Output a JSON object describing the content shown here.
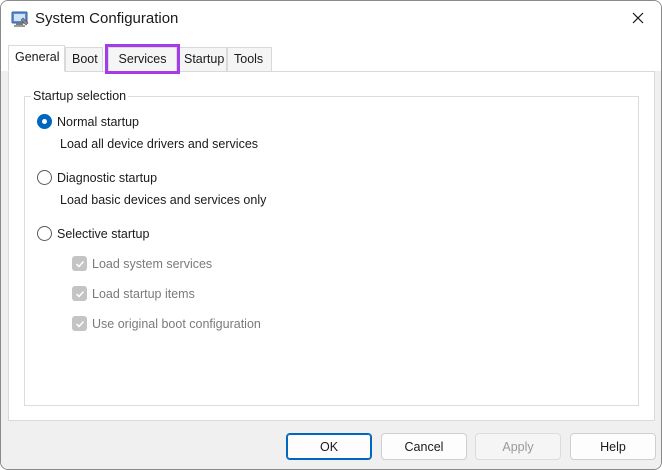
{
  "window": {
    "title": "System Configuration",
    "app_icon": "system-config-icon",
    "close_icon": "close-icon"
  },
  "tabs": [
    {
      "label": "General",
      "active": true
    },
    {
      "label": "Boot",
      "active": false
    },
    {
      "label": "Services",
      "active": false,
      "highlighted": true
    },
    {
      "label": "Startup",
      "active": false
    },
    {
      "label": "Tools",
      "active": false
    }
  ],
  "startup_selection": {
    "label": "Startup selection",
    "normal": {
      "label": "Normal startup",
      "description": "Load all device drivers and services",
      "selected": true
    },
    "diagnostic": {
      "label": "Diagnostic startup",
      "description": "Load basic devices and services only",
      "selected": false
    },
    "selective": {
      "label": "Selective startup",
      "selected": false,
      "options": [
        {
          "label": "Load system services",
          "checked": true,
          "disabled": true
        },
        {
          "label": "Load startup items",
          "checked": true,
          "disabled": true
        },
        {
          "label": "Use original boot configuration",
          "checked": true,
          "disabled": true
        }
      ]
    }
  },
  "buttons": {
    "ok": "OK",
    "cancel": "Cancel",
    "apply": "Apply",
    "help": "Help"
  },
  "colors": {
    "accent": "#0067c0",
    "highlight_outline": "#a63ce8"
  }
}
